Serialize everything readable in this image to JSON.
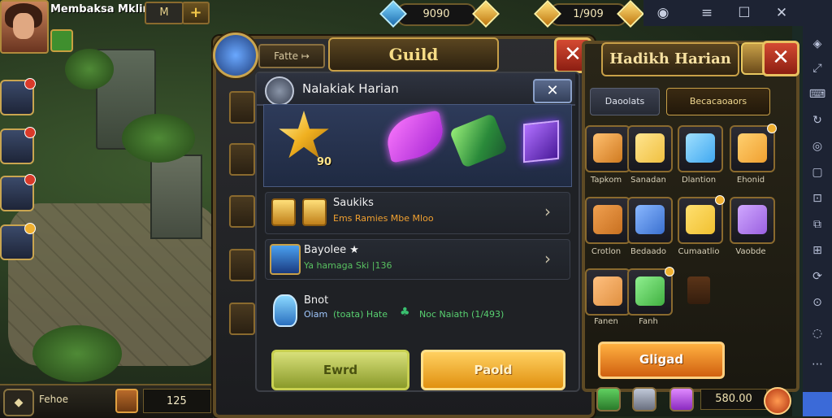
{
  "player": {
    "name": "Membaksa Mklin",
    "level": "M",
    "add": "+"
  },
  "resources": {
    "gems": "9090",
    "gold": "1/909"
  },
  "guild_panel": {
    "title": "Guild",
    "side_tab": "Fatte ↦",
    "close": "✕"
  },
  "daily_inner": {
    "title": "Nalakiak Harian",
    "close": "✕",
    "reward_count": "90",
    "rows": [
      {
        "title": "Saukiks",
        "subtitle": "Ems Ramies Mbe Mloo",
        "subtitle_color": "#f0a030"
      },
      {
        "title": "Bayolee ★",
        "subtitle": "Ya hamaga Ski |136",
        "subtitle_color": "#58c060"
      },
      {
        "title": "Bnot",
        "subtitle": "Oiam",
        "subtitle2": "(toata) Hate",
        "subtitle3": "Noc Naiath (1/493)",
        "subtitle_color": "#a0c8ff",
        "subtitle2_color": "#58d070",
        "subtitle3_color": "#58d070"
      }
    ],
    "btn_left": "Ewrd",
    "btn_right": "Paold"
  },
  "daily_panel": {
    "title": "Hadikh Harian",
    "close": "✕",
    "tab_a": "Daoolats",
    "tab_b": "Becacaoaors",
    "items": [
      {
        "label": "Tapkom",
        "color": "#d07a20"
      },
      {
        "label": "Sanadan",
        "color": "#f0c040"
      },
      {
        "label": "Dlantion",
        "color": "#40a8f0"
      },
      {
        "label": "Ehonid",
        "color": "#f0a030"
      },
      {
        "label": "Crotlon",
        "color": "#c87020"
      },
      {
        "label": "Bedaado",
        "color": "#3a70d0"
      },
      {
        "label": "Cumaatlio",
        "color": "#f0c030"
      },
      {
        "label": "Vaobde",
        "color": "#9a60e0"
      },
      {
        "label": "Fanen",
        "color": "#e09040"
      },
      {
        "label": "Fanh",
        "color": "#40b040"
      }
    ],
    "claim": "Gligad",
    "score": "580.00"
  },
  "chat": {
    "arrow": "◆",
    "label": "Fehoe",
    "count": "125"
  },
  "window": {
    "minimize": "—",
    "maximize": "☐",
    "close": "✕",
    "menu": "≡",
    "settings": "◉"
  },
  "colors": {
    "accent_gold": "#c8a048",
    "panel_bg": "#1f2125",
    "btn_green": "#c8d050",
    "btn_orange": "#e09010"
  }
}
